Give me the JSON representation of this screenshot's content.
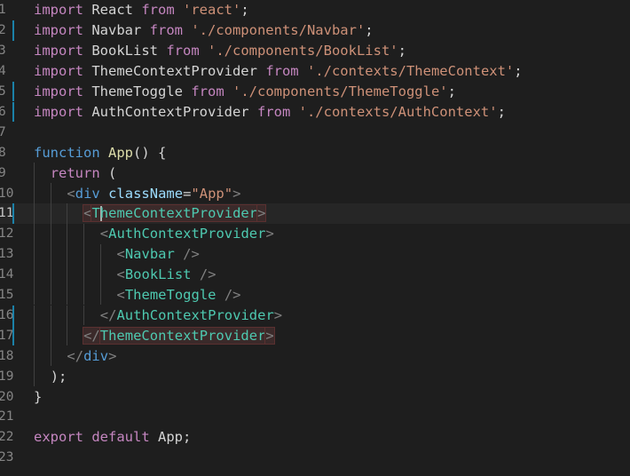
{
  "lines": [
    {
      "num": "1",
      "indent": 0,
      "mod": false,
      "cur": false,
      "tokens": [
        {
          "t": "import",
          "c": "kw"
        },
        {
          "t": " React ",
          "c": "id"
        },
        {
          "t": "from",
          "c": "kw"
        },
        {
          "t": " 'react'",
          "c": "str"
        },
        {
          "t": ";",
          "c": "punct"
        }
      ]
    },
    {
      "num": "2",
      "indent": 0,
      "mod": true,
      "cur": false,
      "tokens": [
        {
          "t": "import",
          "c": "kw"
        },
        {
          "t": " Navbar ",
          "c": "id"
        },
        {
          "t": "from",
          "c": "kw"
        },
        {
          "t": " './components/Navbar'",
          "c": "str"
        },
        {
          "t": ";",
          "c": "punct"
        }
      ]
    },
    {
      "num": "3",
      "indent": 0,
      "mod": false,
      "cur": false,
      "tokens": [
        {
          "t": "import",
          "c": "kw"
        },
        {
          "t": " BookList ",
          "c": "id"
        },
        {
          "t": "from",
          "c": "kw"
        },
        {
          "t": " './components/BookList'",
          "c": "str"
        },
        {
          "t": ";",
          "c": "punct"
        }
      ]
    },
    {
      "num": "4",
      "indent": 0,
      "mod": false,
      "cur": false,
      "tokens": [
        {
          "t": "import",
          "c": "kw"
        },
        {
          "t": " ThemeContextProvider ",
          "c": "id"
        },
        {
          "t": "from",
          "c": "kw"
        },
        {
          "t": " './contexts/ThemeContext'",
          "c": "str"
        },
        {
          "t": ";",
          "c": "punct"
        }
      ]
    },
    {
      "num": "5",
      "indent": 0,
      "mod": true,
      "cur": false,
      "tokens": [
        {
          "t": "import",
          "c": "kw"
        },
        {
          "t": " ThemeToggle ",
          "c": "id"
        },
        {
          "t": "from",
          "c": "kw"
        },
        {
          "t": " './components/ThemeToggle'",
          "c": "str"
        },
        {
          "t": ";",
          "c": "punct"
        }
      ]
    },
    {
      "num": "6",
      "indent": 0,
      "mod": true,
      "cur": false,
      "tokens": [
        {
          "t": "import",
          "c": "kw"
        },
        {
          "t": " AuthContextProvider ",
          "c": "id"
        },
        {
          "t": "from",
          "c": "kw"
        },
        {
          "t": " './contexts/AuthContext'",
          "c": "str"
        },
        {
          "t": ";",
          "c": "punct"
        }
      ]
    },
    {
      "num": "7",
      "indent": 0,
      "mod": false,
      "cur": false,
      "tokens": []
    },
    {
      "num": "8",
      "indent": 0,
      "mod": false,
      "cur": false,
      "tokens": [
        {
          "t": "function",
          "c": "tagkw"
        },
        {
          "t": " ",
          "c": "id"
        },
        {
          "t": "App",
          "c": "fn"
        },
        {
          "t": "() {",
          "c": "punct"
        }
      ]
    },
    {
      "num": "9",
      "indent": 1,
      "mod": false,
      "cur": false,
      "tokens": [
        {
          "t": "return",
          "c": "kw"
        },
        {
          "t": " (",
          "c": "punct"
        }
      ]
    },
    {
      "num": "10",
      "indent": 2,
      "mod": false,
      "cur": false,
      "tokens": [
        {
          "t": "<",
          "c": "tagp"
        },
        {
          "t": "div",
          "c": "tagkw"
        },
        {
          "t": " ",
          "c": "id"
        },
        {
          "t": "className",
          "c": "attr"
        },
        {
          "t": "=",
          "c": "punct"
        },
        {
          "t": "\"App\"",
          "c": "str"
        },
        {
          "t": ">",
          "c": "tagp"
        }
      ]
    },
    {
      "num": "11",
      "indent": 3,
      "mod": true,
      "cur": true,
      "tokens": [
        {
          "t": "<",
          "c": "tagp",
          "m": true
        },
        {
          "t": "ThemeContextProvider",
          "c": "tag",
          "m": true,
          "cursor": true
        },
        {
          "t": ">",
          "c": "tagp",
          "m": true
        }
      ]
    },
    {
      "num": "12",
      "indent": 4,
      "mod": false,
      "cur": false,
      "tokens": [
        {
          "t": "<",
          "c": "tagp"
        },
        {
          "t": "AuthContextProvider",
          "c": "tag"
        },
        {
          "t": ">",
          "c": "tagp"
        }
      ]
    },
    {
      "num": "13",
      "indent": 5,
      "mod": false,
      "cur": false,
      "tokens": [
        {
          "t": "<",
          "c": "tagp"
        },
        {
          "t": "Navbar",
          "c": "tag"
        },
        {
          "t": " />",
          "c": "tagp"
        }
      ]
    },
    {
      "num": "14",
      "indent": 5,
      "mod": false,
      "cur": false,
      "tokens": [
        {
          "t": "<",
          "c": "tagp"
        },
        {
          "t": "BookList",
          "c": "tag"
        },
        {
          "t": " />",
          "c": "tagp"
        }
      ]
    },
    {
      "num": "15",
      "indent": 5,
      "mod": false,
      "cur": false,
      "tokens": [
        {
          "t": "<",
          "c": "tagp"
        },
        {
          "t": "ThemeToggle",
          "c": "tag"
        },
        {
          "t": " />",
          "c": "tagp"
        }
      ]
    },
    {
      "num": "16",
      "indent": 4,
      "mod": true,
      "cur": false,
      "tokens": [
        {
          "t": "</",
          "c": "tagp"
        },
        {
          "t": "AuthContextProvider",
          "c": "tag"
        },
        {
          "t": ">",
          "c": "tagp"
        }
      ]
    },
    {
      "num": "17",
      "indent": 3,
      "mod": true,
      "cur": false,
      "tokens": [
        {
          "t": "</",
          "c": "tagp",
          "m": true
        },
        {
          "t": "ThemeContextProvider",
          "c": "tag",
          "m": true
        },
        {
          "t": ">",
          "c": "tagp",
          "m": true
        }
      ]
    },
    {
      "num": "18",
      "indent": 2,
      "mod": false,
      "cur": false,
      "tokens": [
        {
          "t": "</",
          "c": "tagp"
        },
        {
          "t": "div",
          "c": "tagkw"
        },
        {
          "t": ">",
          "c": "tagp"
        }
      ]
    },
    {
      "num": "19",
      "indent": 1,
      "mod": false,
      "cur": false,
      "tokens": [
        {
          "t": ");",
          "c": "punct"
        }
      ]
    },
    {
      "num": "20",
      "indent": 0,
      "mod": false,
      "cur": false,
      "tokens": [
        {
          "t": "}",
          "c": "punct"
        }
      ]
    },
    {
      "num": "21",
      "indent": 0,
      "mod": false,
      "cur": false,
      "tokens": []
    },
    {
      "num": "22",
      "indent": 0,
      "mod": false,
      "cur": false,
      "tokens": [
        {
          "t": "export",
          "c": "kw"
        },
        {
          "t": " ",
          "c": "id"
        },
        {
          "t": "default",
          "c": "kw"
        },
        {
          "t": " App;",
          "c": "id"
        }
      ]
    },
    {
      "num": "23",
      "indent": 0,
      "mod": false,
      "cur": false,
      "tokens": []
    }
  ]
}
